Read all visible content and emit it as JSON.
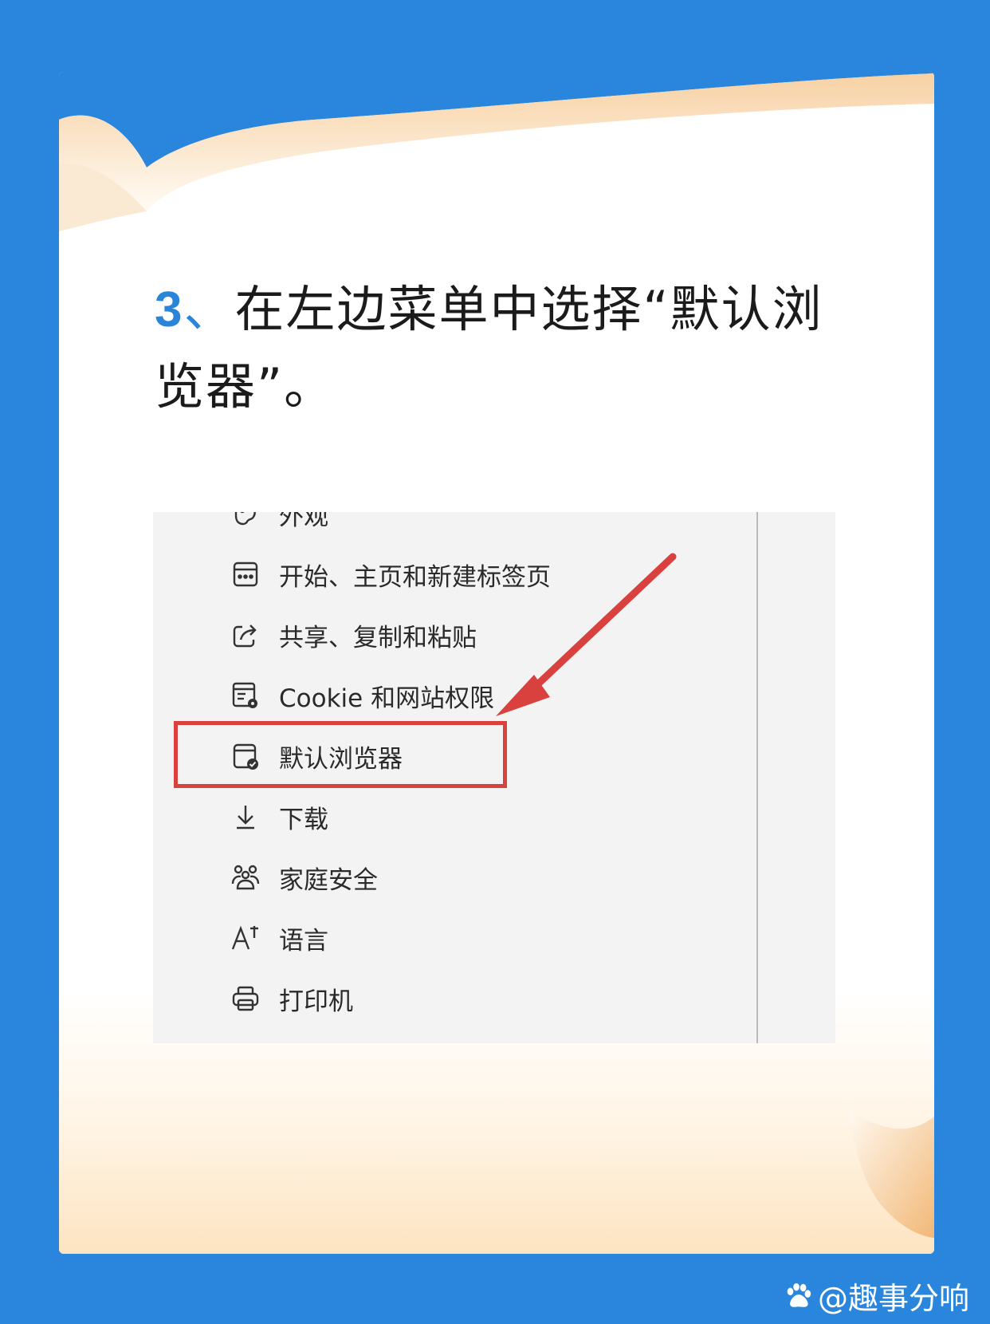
{
  "step": {
    "number": "3",
    "separator": "、",
    "text": "在左边菜单中选择“默认浏览器”。"
  },
  "menu": {
    "items": [
      {
        "icon": "appearance-icon",
        "label": "外观"
      },
      {
        "icon": "start-home-icon",
        "label": "开始、主页和新建标签页"
      },
      {
        "icon": "share-icon",
        "label": "共享、复制和粘贴"
      },
      {
        "icon": "cookie-permissions-icon",
        "label": "Cookie 和网站权限"
      },
      {
        "icon": "default-browser-icon",
        "label": "默认浏览器",
        "highlighted": true
      },
      {
        "icon": "download-icon",
        "label": "下载"
      },
      {
        "icon": "family-safety-icon",
        "label": "家庭安全"
      },
      {
        "icon": "language-icon",
        "label": "语言"
      },
      {
        "icon": "printer-icon",
        "label": "打印机"
      }
    ]
  },
  "watermark": {
    "text": "@趣事分响",
    "icon": "baidu-paw-icon"
  },
  "colors": {
    "background": "#2986dc",
    "accent": "#2a85d8",
    "highlight": "#d8413d",
    "paper_curl": "#f8d6a8"
  }
}
